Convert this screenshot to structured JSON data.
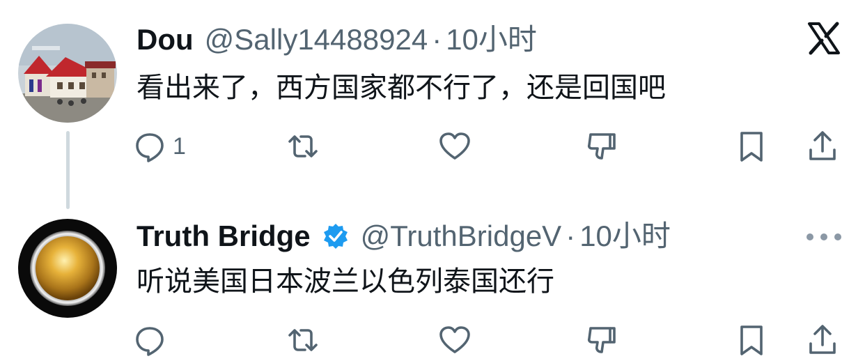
{
  "tweets": [
    {
      "display_name": "Dou",
      "handle": "@Sally14488924",
      "separator": "·",
      "time": "10小时",
      "text": "看出来了，西方国家都不行了，还是回国吧",
      "reply_count": "1",
      "verified": false
    },
    {
      "display_name": "Truth Bridge",
      "handle": "@TruthBridgeV",
      "separator": "·",
      "time": "10小时",
      "text": "听说美国日本波兰以色列泰国还行",
      "reply_count": "",
      "verified": true
    }
  ],
  "icons": {
    "top_right_first": "x-logo-icon",
    "top_right_second": "more-dots-icon",
    "actions": [
      "reply-icon",
      "retweet-icon",
      "like-icon",
      "dislike-icon",
      "bookmark-icon",
      "share-icon"
    ]
  },
  "colors": {
    "text": "#0f1419",
    "secondary": "#536471",
    "verified_blue": "#1d9bf0",
    "thread_line": "#cfd9de"
  }
}
